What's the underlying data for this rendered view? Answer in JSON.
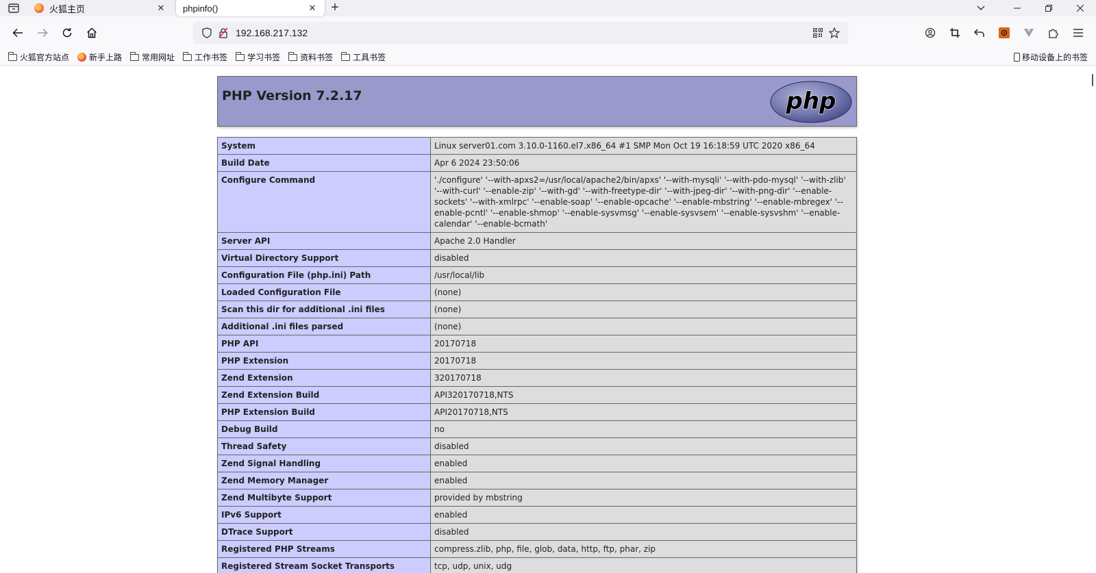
{
  "tabs": [
    {
      "title": "火狐主页",
      "active": false
    },
    {
      "title": "phpinfo()",
      "active": true
    }
  ],
  "address": {
    "url": "192.168.217.132"
  },
  "bookmarks": [
    {
      "label": "火狐官方站点",
      "icon": "folder-icon"
    },
    {
      "label": "新手上路",
      "icon": "firefox-icon"
    },
    {
      "label": "常用网址",
      "icon": "folder-icon"
    },
    {
      "label": "工作书签",
      "icon": "folder-icon"
    },
    {
      "label": "学习书签",
      "icon": "folder-icon"
    },
    {
      "label": "资料书签",
      "icon": "folder-icon"
    },
    {
      "label": "工具书签",
      "icon": "folder-icon"
    }
  ],
  "mobile_bookmarks": "移动设备上的书签",
  "colors": {
    "header_bg": "#9999cc",
    "key_bg": "#ccccff",
    "value_bg": "#dddddd"
  },
  "php": {
    "title": "PHP Version 7.2.17",
    "logo_text": "php",
    "rows": [
      {
        "key": "System",
        "value": "Linux server01.com 3.10.0-1160.el7.x86_64 #1 SMP Mon Oct 19 16:18:59 UTC 2020 x86_64"
      },
      {
        "key": "Build Date",
        "value": "Apr 6 2024 23:50:06"
      },
      {
        "key": "Configure Command",
        "value": "'./configure' '--with-apxs2=/usr/local/apache2/bin/apxs' '--with-mysqli' '--with-pdo-mysql' '--with-zlib' '--with-curl' '--enable-zip' '--with-gd' '--with-freetype-dir' '--with-jpeg-dir' '--with-png-dir' '--enable-sockets' '--with-xmlrpc' '--enable-soap' '--enable-opcache' '--enable-mbstring' '--enable-mbregex' '--enable-pcntl' '--enable-shmop' '--enable-sysvmsg' '--enable-sysvsem' '--enable-sysvshm' '--enable-calendar' '--enable-bcmath'"
      },
      {
        "key": "Server API",
        "value": "Apache 2.0 Handler"
      },
      {
        "key": "Virtual Directory Support",
        "value": "disabled"
      },
      {
        "key": "Configuration File (php.ini) Path",
        "value": "/usr/local/lib"
      },
      {
        "key": "Loaded Configuration File",
        "value": "(none)"
      },
      {
        "key": "Scan this dir for additional .ini files",
        "value": "(none)"
      },
      {
        "key": "Additional .ini files parsed",
        "value": "(none)"
      },
      {
        "key": "PHP API",
        "value": "20170718"
      },
      {
        "key": "PHP Extension",
        "value": "20170718"
      },
      {
        "key": "Zend Extension",
        "value": "320170718"
      },
      {
        "key": "Zend Extension Build",
        "value": "API320170718,NTS"
      },
      {
        "key": "PHP Extension Build",
        "value": "API20170718,NTS"
      },
      {
        "key": "Debug Build",
        "value": "no"
      },
      {
        "key": "Thread Safety",
        "value": "disabled"
      },
      {
        "key": "Zend Signal Handling",
        "value": "enabled"
      },
      {
        "key": "Zend Memory Manager",
        "value": "enabled"
      },
      {
        "key": "Zend Multibyte Support",
        "value": "provided by mbstring"
      },
      {
        "key": "IPv6 Support",
        "value": "enabled"
      },
      {
        "key": "DTrace Support",
        "value": "disabled"
      },
      {
        "key": "Registered PHP Streams",
        "value": "compress.zlib, php, file, glob, data, http, ftp, phar, zip"
      },
      {
        "key": "Registered Stream Socket Transports",
        "value": "tcp, udp, unix, udg"
      }
    ]
  }
}
